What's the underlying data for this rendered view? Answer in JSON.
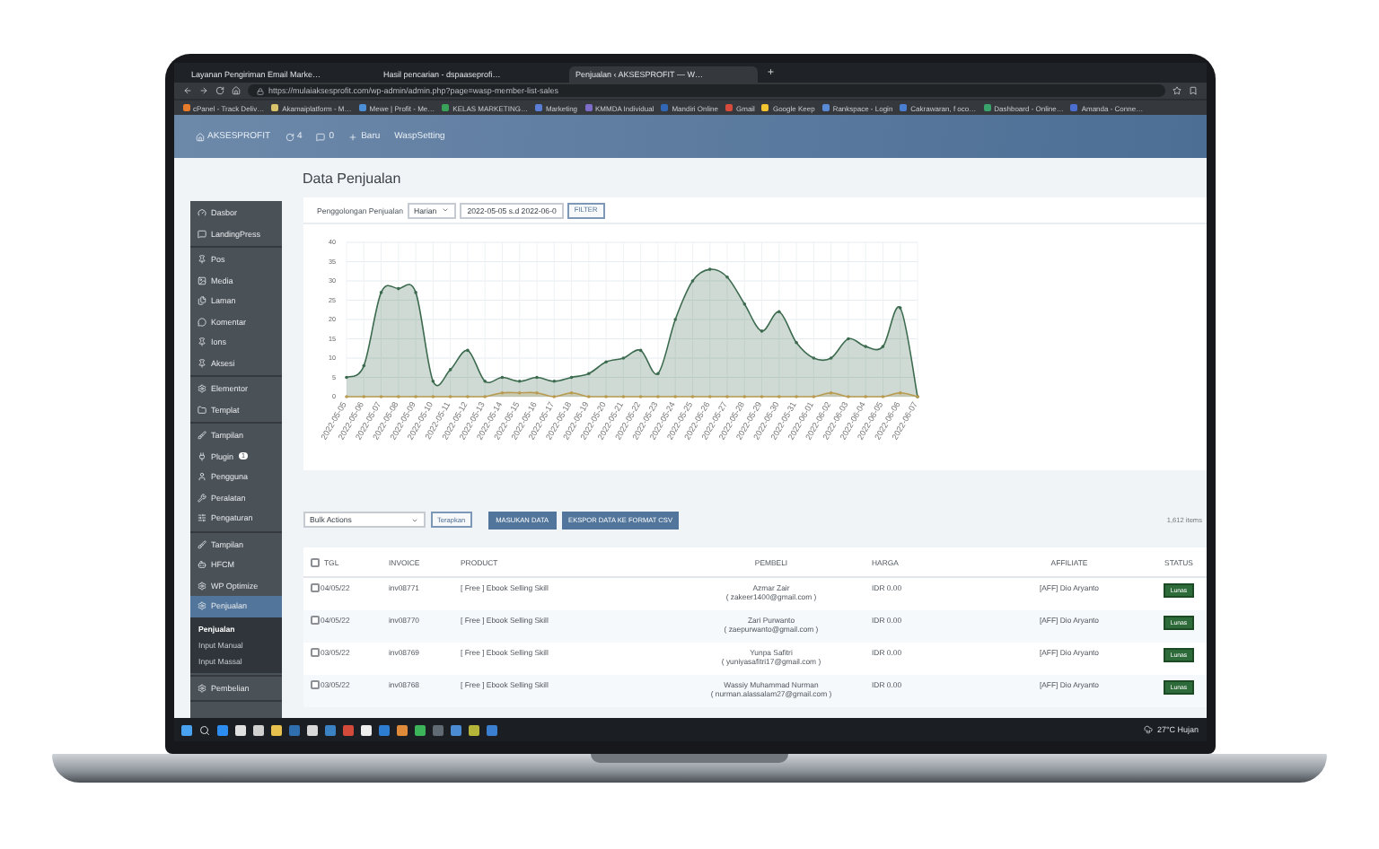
{
  "browser": {
    "tabs": [
      {
        "label": "Layanan Pengiriman Email Marke…",
        "selected": false
      },
      {
        "label": "Hasil pencarian - dspaaseprofi…",
        "selected": false
      },
      {
        "label": "Penjualan ‹ AKSESPROFIT — W…",
        "selected": true
      }
    ],
    "new_tab": "+",
    "url": "https://mulaiaksesprofit.com/wp-admin/admin.php?page=wasp-member-list-sales",
    "bookmarks": [
      "cPanel - Track Deliv…",
      "Akamaiplatform - M…",
      "Mewe | Profit - Me…",
      "KELAS MARKETING…",
      "Marketing",
      "KMMDA Individual",
      "Mandiri Online",
      "Gmail",
      "Google Keep",
      "Rankspace - Login",
      "Cakrawaran, f oco…",
      "Dashboard - Online…",
      "Amanda - Conne…"
    ]
  },
  "admin_bar": {
    "site": "AKSESPROFIT",
    "updates": "4",
    "comments": "0",
    "new": "Baru",
    "extra": "WaspSetting"
  },
  "sidebar": {
    "groups": [
      [
        {
          "label": "Dasbor",
          "selected": false
        },
        {
          "label": "LandingPress",
          "selected": false
        }
      ],
      [
        {
          "label": "Pos",
          "selected": false
        },
        {
          "label": "Media",
          "selected": false
        },
        {
          "label": "Laman",
          "selected": false
        },
        {
          "label": "Komentar",
          "selected": false
        },
        {
          "label": "Ions",
          "selected": false
        },
        {
          "label": "Aksesi",
          "selected": false
        }
      ],
      [
        {
          "label": "Elementor",
          "selected": false
        },
        {
          "label": "Templat",
          "selected": false
        }
      ],
      [
        {
          "label": "Tampilan",
          "selected": false
        },
        {
          "label": "Plugin",
          "selected": false,
          "badge": "1"
        },
        {
          "label": "Pengguna",
          "selected": false
        },
        {
          "label": "Peralatan",
          "selected": false
        },
        {
          "label": "Pengaturan",
          "selected": false
        }
      ],
      [
        {
          "label": "Tampilan",
          "selected": false
        },
        {
          "label": "HFCM",
          "selected": false
        },
        {
          "label": "WP Optimize",
          "selected": false
        },
        {
          "label": "Penjualan",
          "selected": true,
          "children": [
            {
              "label": "Penjualan",
              "selected": true
            },
            {
              "label": "Input Manual",
              "selected": false
            },
            {
              "label": "Input Massal",
              "selected": false
            }
          ]
        }
      ],
      [
        {
          "label": "Pembelian",
          "selected": false
        }
      ]
    ]
  },
  "page_title": "Data Penjualan",
  "filter": {
    "label": "Penggolongan Penjualan",
    "period": "Harian",
    "date_range": "2022-05-05 s.d 2022-06-0",
    "button": "FILTER"
  },
  "chart_data": {
    "type": "area",
    "categories": [
      "2022-05-05",
      "2022-05-06",
      "2022-05-07",
      "2022-05-08",
      "2022-05-09",
      "2022-05-10",
      "2022-05-11",
      "2022-05-12",
      "2022-05-13",
      "2022-05-14",
      "2022-05-15",
      "2022-05-16",
      "2022-05-17",
      "2022-05-18",
      "2022-05-19",
      "2022-05-20",
      "2022-05-21",
      "2022-05-22",
      "2022-05-23",
      "2022-05-24",
      "2022-05-25",
      "2022-05-26",
      "2022-05-27",
      "2022-05-28",
      "2022-05-29",
      "2022-05-30",
      "2022-05-31",
      "2022-06-01",
      "2022-06-02",
      "2022-06-03",
      "2022-06-04",
      "2022-06-05",
      "2022-06-06",
      "2022-06-07"
    ],
    "series": [
      {
        "color": "#3d6b4f",
        "values": [
          5,
          8,
          27,
          28,
          27,
          4,
          7,
          12,
          4,
          5,
          4,
          5,
          4,
          5,
          6,
          9,
          10,
          12,
          6,
          20,
          30,
          33,
          31,
          24,
          17,
          22,
          14,
          10,
          10,
          15,
          13,
          13,
          23,
          0
        ]
      },
      {
        "color": "#b89a50",
        "values": [
          0,
          0,
          0,
          0,
          0,
          0,
          0,
          0,
          0,
          1,
          1,
          1,
          0,
          1,
          0,
          0,
          0,
          0,
          0,
          0,
          0,
          0,
          0,
          0,
          0,
          0,
          0,
          0,
          1,
          0,
          0,
          0,
          1,
          0
        ]
      }
    ],
    "grid": true,
    "ylim": [
      0,
      40
    ],
    "yticks": [
      0,
      5,
      10,
      15,
      20,
      25,
      30,
      35,
      40
    ]
  },
  "actions": {
    "bulk": "Bulk Actions",
    "apply": "Terapkan",
    "buttons": [
      "MASUKAN DATA",
      "EKSPOR DATA KE FORMAT CSV"
    ],
    "count": "1,612 items"
  },
  "table": {
    "select_all_checked": false,
    "columns": [
      "TGL",
      "INVOICE",
      "PRODUCT",
      "PEMBELI",
      "HARGA",
      "AFFILIATE",
      "STATUS"
    ],
    "rows": [
      {
        "checked": false,
        "cells": [
          "04/05/22",
          "inv08771",
          "[ Free ] Ebook Selling Skill",
          "Azmar Zair",
          "IDR 0.00",
          "[AFF] Dio Aryanto",
          "Lunas"
        ],
        "email": "( zakeer1400@gmail.com )"
      },
      {
        "checked": false,
        "cells": [
          "04/05/22",
          "inv08770",
          "[ Free ] Ebook Selling Skill",
          "Zari Purwanto",
          "IDR 0.00",
          "[AFF] Dio Aryanto",
          "Lunas"
        ],
        "email": "( zaepurwanto@gmail.com )"
      },
      {
        "checked": false,
        "cells": [
          "03/05/22",
          "inv08769",
          "[ Free ] Ebook Selling Skill",
          "Yunpa Safitri",
          "IDR 0.00",
          "[AFF] Dio Aryanto",
          "Lunas"
        ],
        "email": "( yuniyasafitri17@gmail.com )"
      },
      {
        "checked": false,
        "cells": [
          "03/05/22",
          "inv08768",
          "[ Free ] Ebook Selling Skill",
          "Wassiy Muhammad Nurman",
          "IDR 0.00",
          "[AFF] Dio Aryanto",
          "Lunas"
        ],
        "email": "( nurman.alassalam27@gmail.com )"
      }
    ]
  },
  "taskbar": {
    "weather": "27°C  Hujan"
  }
}
